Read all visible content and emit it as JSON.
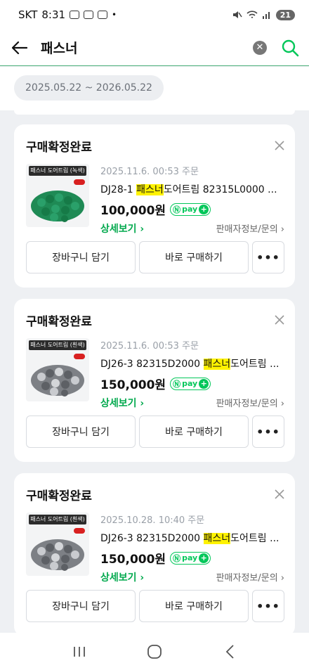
{
  "status_bar": {
    "carrier": "SKT",
    "time": "8:31",
    "battery": "21"
  },
  "header": {
    "search_query": "패스너"
  },
  "filter": {
    "date_range": "2025.05.22 ~ 2026.05.22"
  },
  "orders": [
    {
      "status": "구매확정완료",
      "date": "2025.11.6. 00:53 주문",
      "title_pre": "DJ28-1 ",
      "title_hl": "패스너",
      "title_post": "도어트림 82315L0000 ...",
      "price": "100,000원",
      "thumb_label": "패스너 도어트림 (녹색)",
      "thumb_color": "#1f8a55",
      "detail": "상세보기 ›",
      "seller": "판매자정보/문의 ›",
      "cart_label": "장바구니 담기",
      "buy_label": "바로 구매하기"
    },
    {
      "status": "구매확정완료",
      "date": "2025.11.6. 00:53 주문",
      "title_pre": "DJ26-3 82315D2000 ",
      "title_hl": "패스너",
      "title_post": "도어트림 ...",
      "price": "150,000원",
      "thumb_label": "패스너 도어트림 (흰색)",
      "thumb_color": "#8e9095",
      "detail": "상세보기 ›",
      "seller": "판매자정보/문의 ›",
      "cart_label": "장바구니 담기",
      "buy_label": "바로 구매하기"
    },
    {
      "status": "구매확정완료",
      "date": "2025.10.28. 10:40 주문",
      "title_pre": "DJ26-3 82315D2000 ",
      "title_hl": "패스너",
      "title_post": "도어트림 ...",
      "price": "150,000원",
      "thumb_label": "패스너 도어트림 (흰색)",
      "thumb_color": "#8e9095",
      "detail": "상세보기 ›",
      "seller": "판매자정보/문의 ›",
      "cart_label": "장바구니 담기",
      "buy_label": "바로 구매하기"
    }
  ],
  "npay": {
    "label": "pay"
  },
  "more_label": "•••",
  "colors": {
    "accent": "#03c75a",
    "highlight": "#fff200",
    "background": "#eef0f3"
  }
}
